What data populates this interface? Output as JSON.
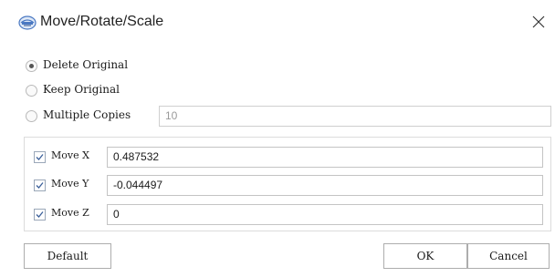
{
  "window": {
    "title": "Move/Rotate/Scale",
    "app_icon": "app-logo-icon",
    "close_icon": "close-icon"
  },
  "options": {
    "delete_original": {
      "label": "Delete Original",
      "selected": true
    },
    "keep_original": {
      "label": "Keep Original",
      "selected": false
    },
    "multiple_copies": {
      "label": "Multiple Copies",
      "selected": false,
      "value": "10"
    }
  },
  "moves": [
    {
      "label": "Move X",
      "checked": true,
      "value": "0.487532"
    },
    {
      "label": "Move Y",
      "checked": true,
      "value": "-0.044497"
    },
    {
      "label": "Move Z",
      "checked": true,
      "value": "0"
    }
  ],
  "buttons": {
    "default": "Default",
    "ok": "OK",
    "cancel": "Cancel"
  },
  "colors": {
    "accent": "#4a78c2",
    "check": "#3a5f9a"
  }
}
